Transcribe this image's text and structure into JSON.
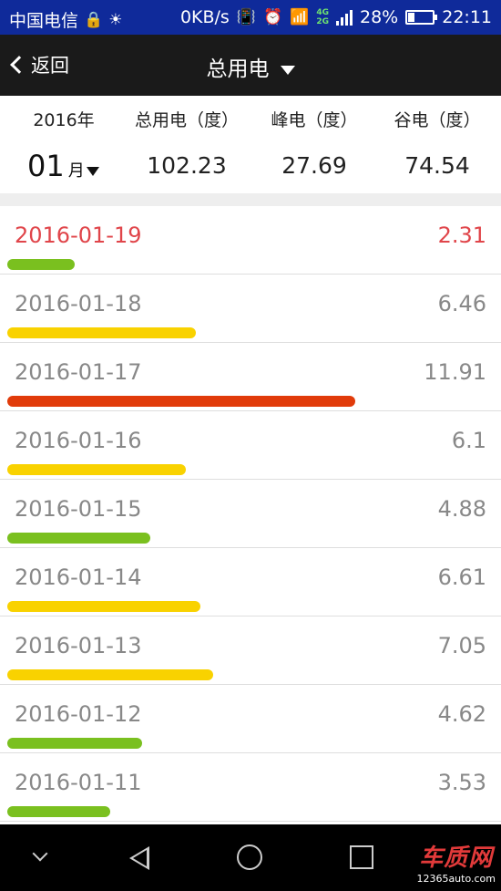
{
  "status_bar": {
    "carrier": "中国电信",
    "speed": "0KB/s",
    "net_4g": "4G",
    "net_2g": "2G",
    "battery_percent_text": "28%",
    "battery_level": 0.28,
    "time": "22:11"
  },
  "header": {
    "back_label": "返回",
    "title": "总用电"
  },
  "summary": {
    "year": "2016年",
    "month": "01",
    "month_unit": "月",
    "total_label": "总用电（度）",
    "peak_label": "峰电（度）",
    "valley_label": "谷电（度）",
    "total_value": "102.23",
    "peak_value": "27.69",
    "valley_value": "74.54"
  },
  "daily": [
    {
      "date": "2016-01-19",
      "value": "2.31",
      "level": "low",
      "active": true
    },
    {
      "date": "2016-01-18",
      "value": "6.46",
      "level": "mid",
      "active": false
    },
    {
      "date": "2016-01-17",
      "value": "11.91",
      "level": "high",
      "active": false
    },
    {
      "date": "2016-01-16",
      "value": "6.1",
      "level": "mid",
      "active": false
    },
    {
      "date": "2016-01-15",
      "value": "4.88",
      "level": "low",
      "active": false
    },
    {
      "date": "2016-01-14",
      "value": "6.61",
      "level": "mid",
      "active": false
    },
    {
      "date": "2016-01-13",
      "value": "7.05",
      "level": "mid",
      "active": false
    },
    {
      "date": "2016-01-12",
      "value": "4.62",
      "level": "low",
      "active": false
    },
    {
      "date": "2016-01-11",
      "value": "3.53",
      "level": "low",
      "active": false
    }
  ],
  "colors": {
    "low": "#7ac01f",
    "mid": "#f9d200",
    "high": "#e13b0a",
    "active_text": "#e0454a"
  },
  "watermark": {
    "brand": "车质网",
    "url": "12365auto.com"
  }
}
